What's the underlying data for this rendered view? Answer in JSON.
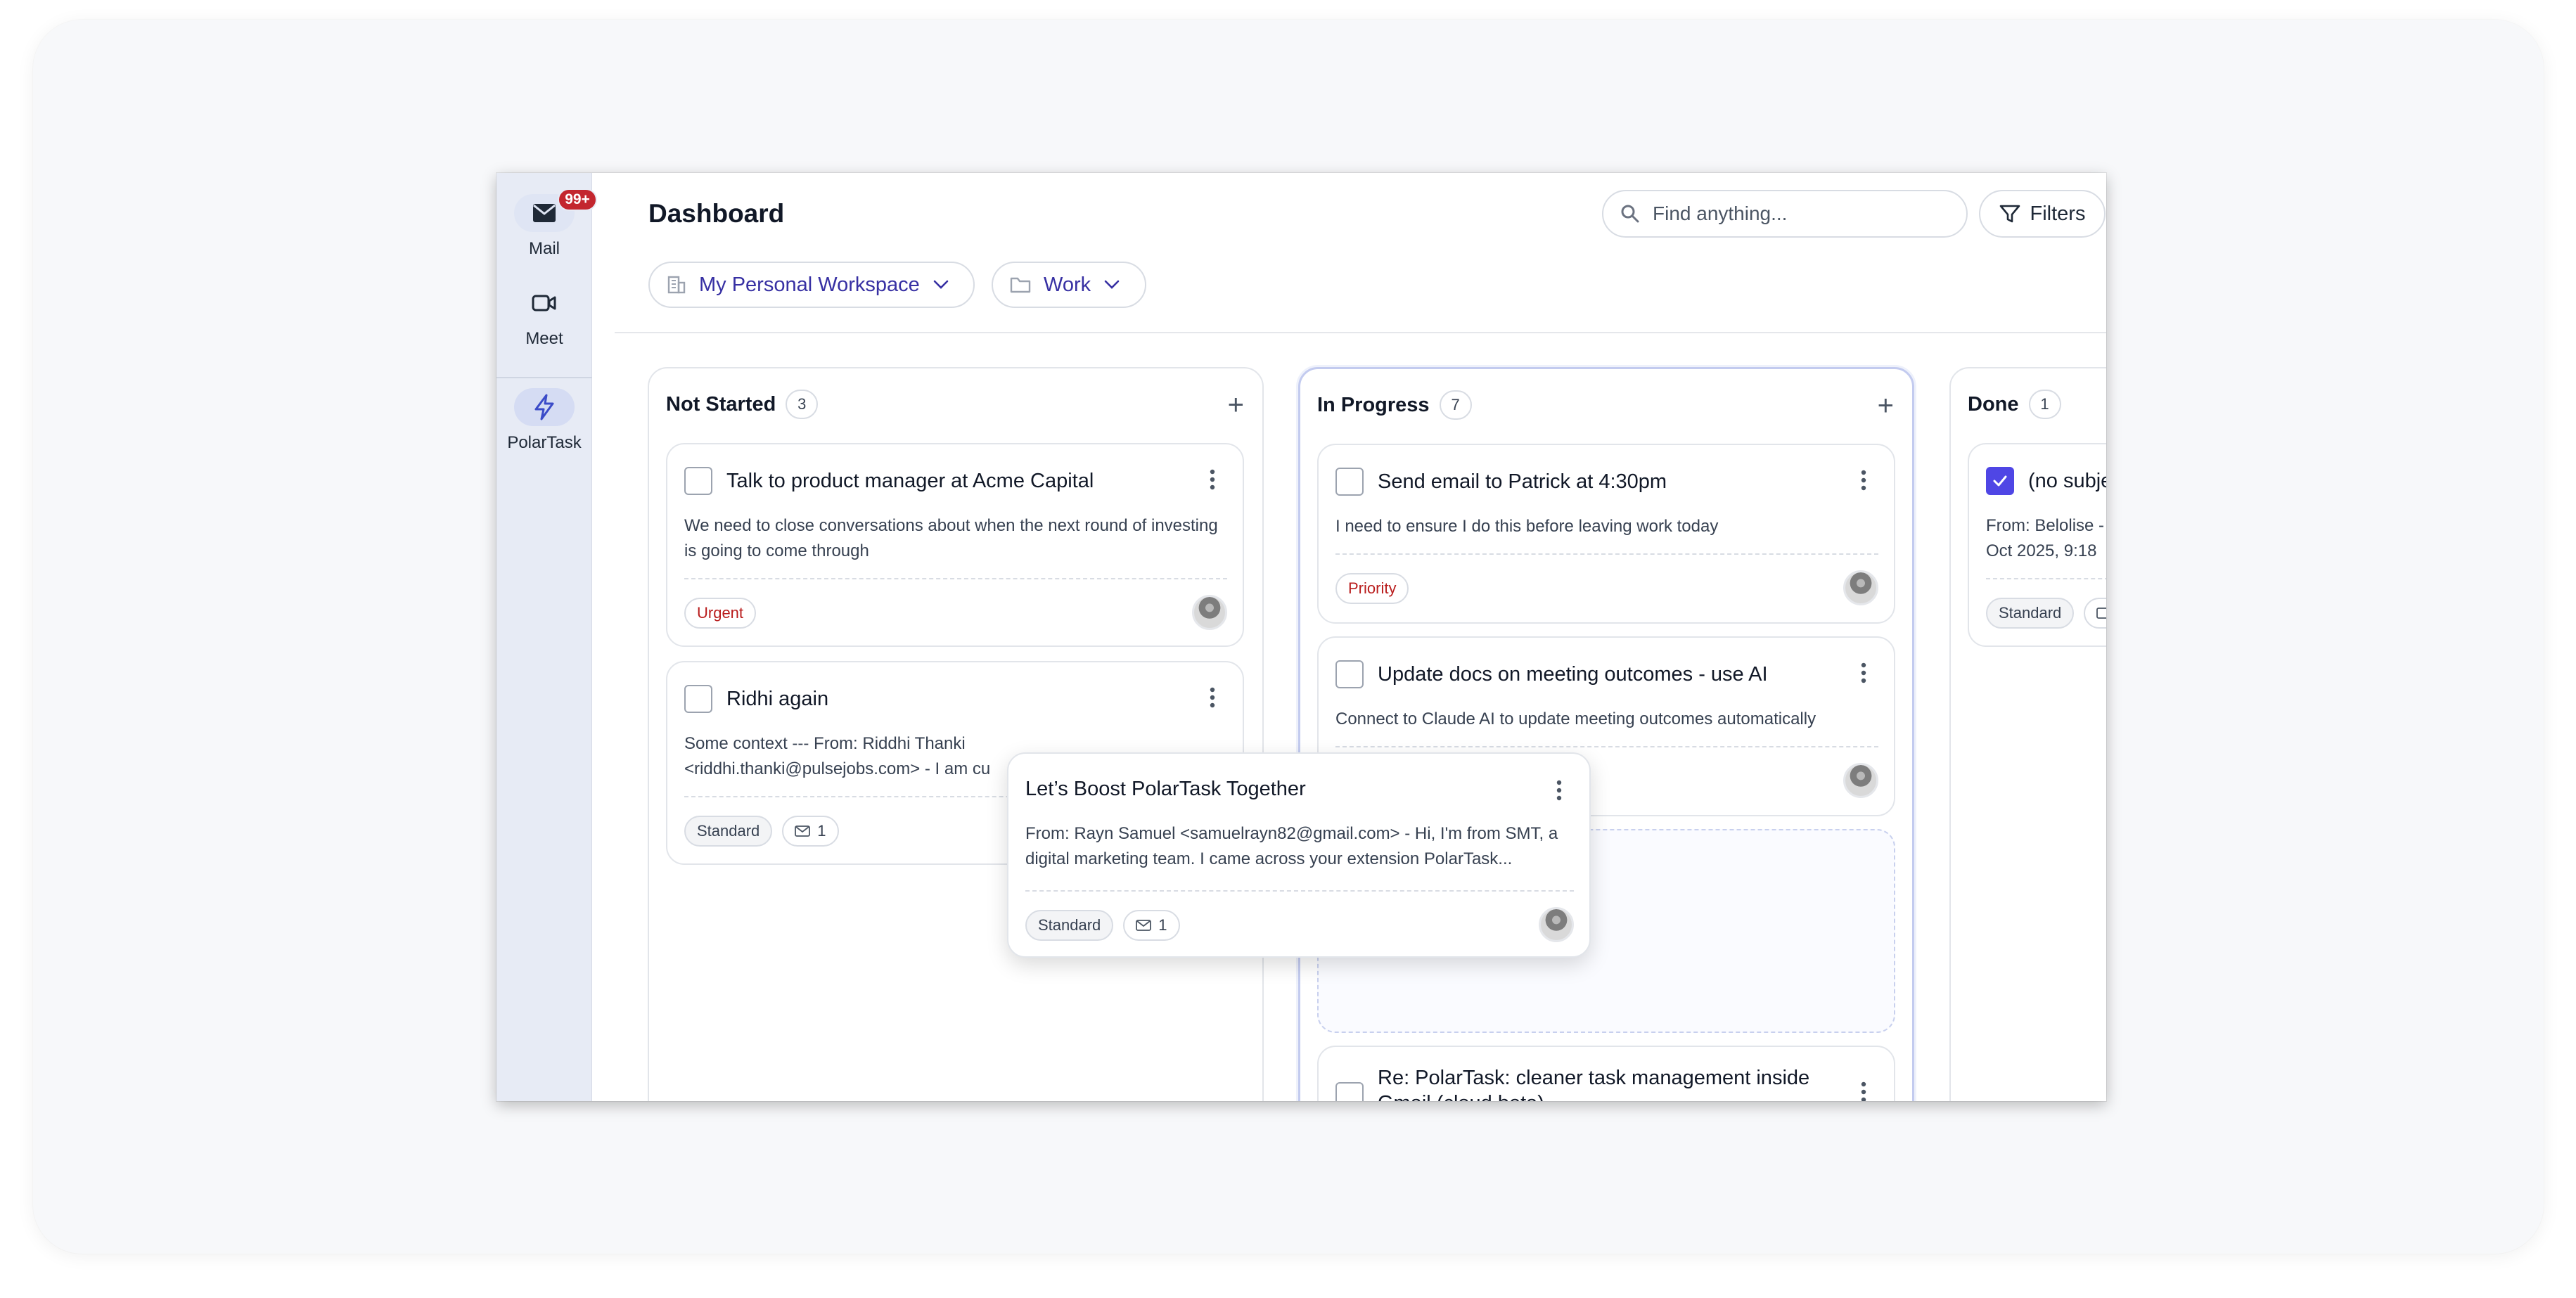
{
  "sidebar": {
    "items": [
      {
        "label": "Mail",
        "icon": "mail-icon",
        "badge": "99+"
      },
      {
        "label": "Meet",
        "icon": "video-icon"
      },
      {
        "label": "PolarTask",
        "icon": "bolt-icon"
      }
    ]
  },
  "header": {
    "title": "Dashboard",
    "search_placeholder": "Find anything...",
    "filters_label": "Filters",
    "workspace_label": "My Personal Workspace",
    "folder_label": "Work"
  },
  "columns": [
    {
      "title": "Not Started",
      "count": "3",
      "cards": [
        {
          "title": "Talk to product manager at Acme Capital",
          "desc": "We need to close conversations about when the next round of investing is going to come through",
          "tag": "Urgent"
        },
        {
          "title": "Ridhi again",
          "desc": "Some context --- From: Riddhi Thanki <riddhi.thanki@pulsejobs.com> - I am cu",
          "tag": "Standard",
          "mail_count": "1"
        }
      ]
    },
    {
      "title": "In Progress",
      "count": "7",
      "cards": [
        {
          "title": "Send email to Patrick at 4:30pm",
          "desc": "I need to ensure I do this before leaving work today",
          "tag": "Priority"
        },
        {
          "title": "Update docs on meeting outcomes - use AI",
          "desc": "Connect to Claude AI to update meeting outcomes automatically"
        },
        {
          "title": "Re: PolarTask: cleaner task management inside Gmail (cloud beta)"
        }
      ]
    },
    {
      "title": "Done",
      "count": "1",
      "cards": [
        {
          "title": "(no subje",
          "desc_line1": "From: Belolise -",
          "desc_line2": "Oct 2025, 9:18",
          "tag": "Standard"
        }
      ]
    }
  ],
  "drag_card": {
    "title": "Let’s Boost PolarTask Together",
    "desc": "From: Rayn Samuel <samuelrayn82@gmail.com> - Hi, I'm from SMT, a digital marketing team. I came across your extension PolarTask...",
    "tag": "Standard",
    "mail_count": "1"
  },
  "colors": {
    "accent": "#4f46e5",
    "badge": "#c3262e",
    "urgent_text": "#b91c1c",
    "sidebar_bg": "#e7ebf5"
  }
}
